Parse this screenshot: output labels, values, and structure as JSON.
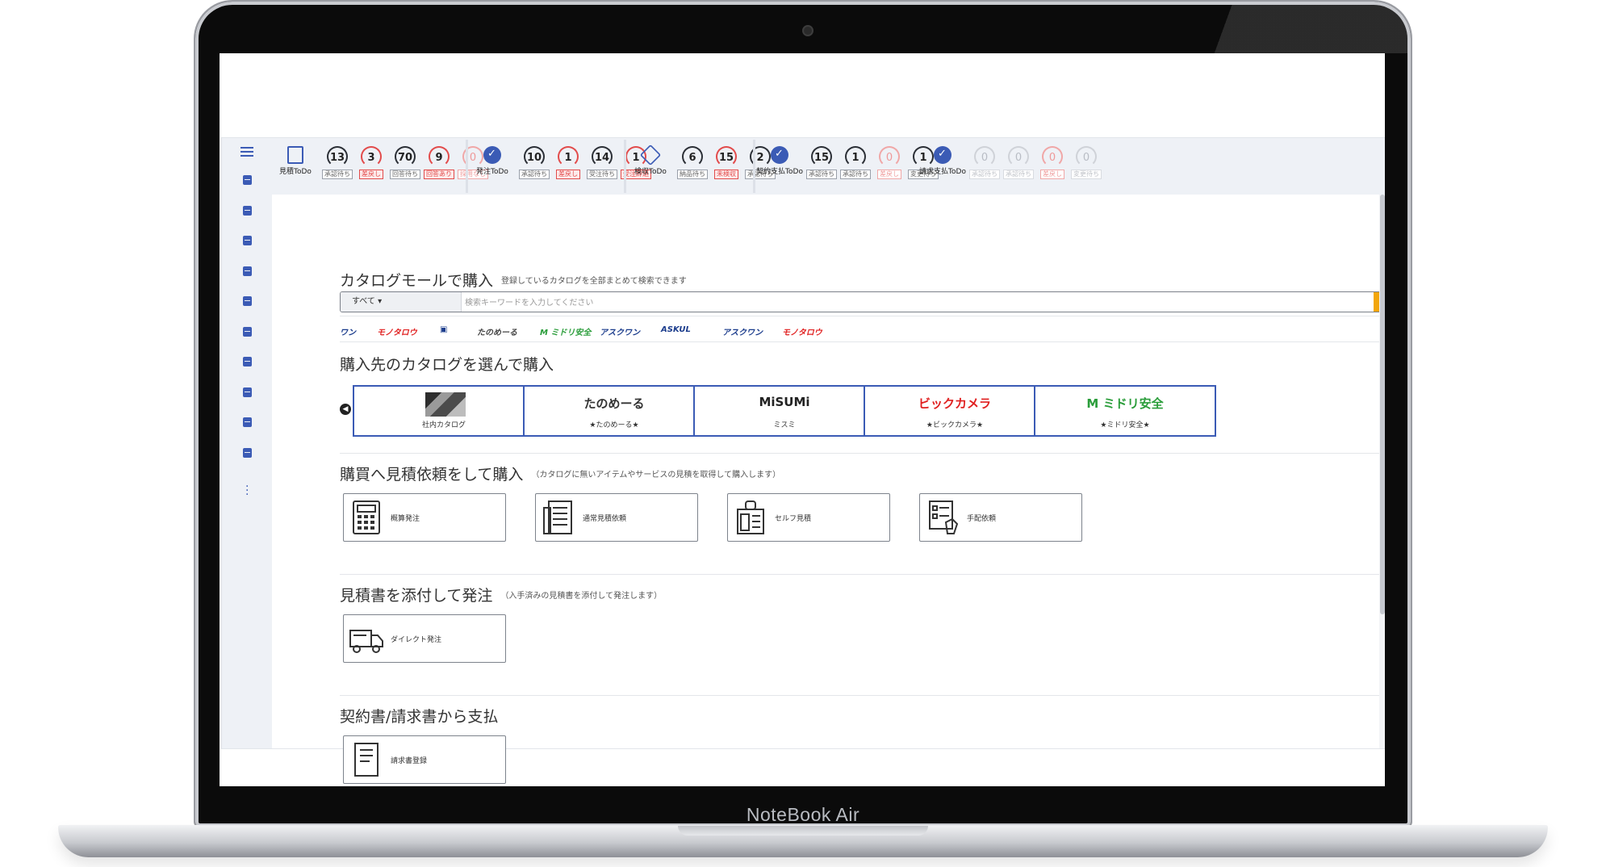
{
  "device": {
    "brand": "NoteBook Air"
  },
  "sidebar": {
    "icon_count": 10
  },
  "topbar": {
    "groups": [
      {
        "main_label": "見積ToDo",
        "icon": "edit-doc-icon",
        "gauges": [
          {
            "value": "13",
            "tag": "承認待ち",
            "style": "dark"
          },
          {
            "value": "3",
            "tag": "差戻し",
            "style": "red"
          },
          {
            "value": "70",
            "tag": "回答待ち",
            "style": "dark"
          },
          {
            "value": "9",
            "tag": "回答あり",
            "style": "red"
          },
          {
            "value": "0",
            "tag": "採用なし",
            "style": "palered"
          }
        ]
      },
      {
        "main_label": "発注ToDo",
        "icon": "check-circle-icon",
        "gauges": [
          {
            "value": "10",
            "tag": "承認待ち",
            "style": "dark"
          },
          {
            "value": "1",
            "tag": "差戻し",
            "style": "red"
          },
          {
            "value": "14",
            "tag": "受注待ち",
            "style": "dark"
          },
          {
            "value": "1",
            "tag": "受注辞退",
            "style": "red"
          }
        ]
      },
      {
        "main_label": "検収ToDo",
        "icon": "box-icon",
        "gauges": [
          {
            "value": "6",
            "tag": "納品待ち",
            "style": "dark"
          },
          {
            "value": "15",
            "tag": "未検収",
            "style": "red"
          },
          {
            "value": "2",
            "tag": "承認待ち",
            "style": "dark"
          }
        ]
      },
      {
        "main_label": "契約支払ToDo",
        "icon": "contract-icon",
        "gauges": [
          {
            "value": "15",
            "tag": "承認待ち",
            "style": "dark"
          },
          {
            "value": "1",
            "tag": "承認待ち",
            "style": "dark"
          },
          {
            "value": "0",
            "tag": "差戻し",
            "style": "palered"
          },
          {
            "value": "1",
            "tag": "変更待ち",
            "style": "dark"
          }
        ]
      },
      {
        "main_label": "請求支払ToDo",
        "icon": "invoice-icon",
        "gauges": [
          {
            "value": "0",
            "tag": "承認待ち",
            "style": "pale"
          },
          {
            "value": "0",
            "tag": "承認待ち",
            "style": "pale"
          },
          {
            "value": "0",
            "tag": "差戻し",
            "style": "palered"
          },
          {
            "value": "0",
            "tag": "変更待ち",
            "style": "pale"
          }
        ]
      }
    ]
  },
  "catalog_mall": {
    "title": "カタログモールで購入",
    "note": "登録しているカタログを全部まとめて検索できます",
    "category": "すべて ▾",
    "search_placeholder": "検索キーワードを入力してください",
    "logos": [
      {
        "text": "ワン",
        "color": "#1b3c8c"
      },
      {
        "text": "モノタロウ",
        "color": "#e02020"
      },
      {
        "text": "▣",
        "color": "#1b3c8c"
      },
      {
        "text": "たのめーる",
        "color": "#444444"
      },
      {
        "text": "M ミドリ安全",
        "color": "#2a9d3a"
      },
      {
        "text": "アスクワン",
        "color": "#1b3c8c"
      },
      {
        "text": "ASKUL",
        "color": "#1b3c8c"
      },
      {
        "text": "アスクワン",
        "color": "#1b3c8c"
      },
      {
        "text": "モノタロウ",
        "color": "#e02020"
      }
    ]
  },
  "supplier_catalog": {
    "title": "購入先のカタログを選んで購入",
    "cards": [
      {
        "logo": "",
        "name": "社内カタログ",
        "color": "#333333"
      },
      {
        "logo": "たのめーる",
        "name": "★たのめーる★",
        "color": "#333333"
      },
      {
        "logo": "MiSUMi",
        "name": "ミスミ",
        "color": "#222222"
      },
      {
        "logo": "ビックカメラ",
        "name": "★ビックカメラ★",
        "color": "#e02020"
      },
      {
        "logo": "M ミドリ安全",
        "name": "★ミドリ安全★",
        "color": "#2a9d3a"
      }
    ]
  },
  "quote_request": {
    "title": "購買へ見積依頼をして購入",
    "note": "（カタログに無いアイテムやサービスの見積を取得して購入します）",
    "buttons": [
      {
        "label": "概算発注",
        "icon": "calculator-icon"
      },
      {
        "label": "通常見積依頼",
        "icon": "newspaper-icon"
      },
      {
        "label": "セルフ見積",
        "icon": "receipt-lock-icon"
      },
      {
        "label": "手配依頼",
        "icon": "checklist-hand-icon"
      }
    ]
  },
  "attach_quote": {
    "title": "見積書を添付して発注",
    "note": "（入手済みの見積書を添付して発注します）",
    "buttons": [
      {
        "label": "ダイレクト発注",
        "icon": "delivery-truck-icon"
      }
    ]
  },
  "contract_payment": {
    "title": "契約書/請求書から支払",
    "buttons": [
      {
        "label": "請求書登録",
        "icon": "invoice-doc-icon"
      }
    ]
  }
}
